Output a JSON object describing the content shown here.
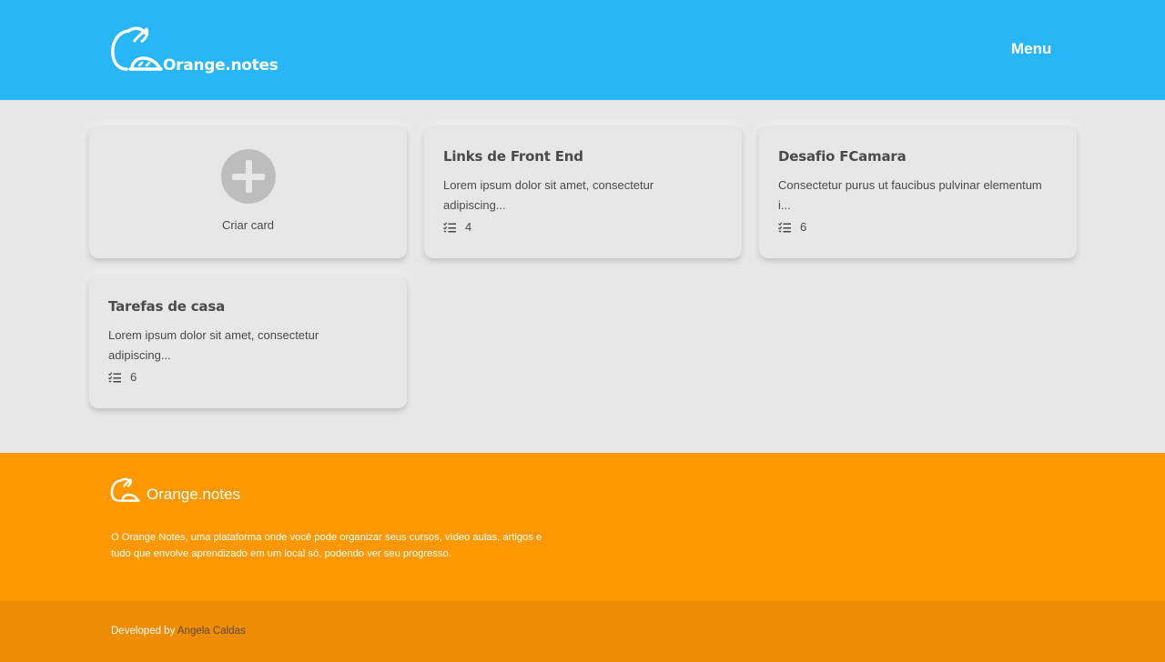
{
  "header": {
    "logo_text": "Orange.notes",
    "menu_label": "Menu"
  },
  "new_card": {
    "label": "Criar card",
    "icon": "plus-circle-icon"
  },
  "cards": [
    {
      "title": "Links de Front End",
      "description": "Lorem ipsum dolor sit amet, consectetur adipiscing...",
      "count": "4"
    },
    {
      "title": "Desafio FCamara",
      "description": "Consectetur purus ut faucibus pulvinar elementum i...",
      "count": "6"
    },
    {
      "title": "Tarefas de casa",
      "description": "Lorem ipsum dolor sit amet, consectetur adipiscing...",
      "count": "6"
    }
  ],
  "footer": {
    "logo_text": "Orange.notes",
    "description": "O Orange Notes, uma plataforma onde você pode organizar seus cursos, vídeo aulas, artigos e tudo que envolve aprendizado em um local só, podendo ver seu progresso.",
    "developed_by": "Developed by",
    "developer_name": "Angela Caldas"
  },
  "colors": {
    "header_bg": "#29b6f6",
    "body_bg": "#e7e7e7",
    "footer_bg": "#ff9800",
    "bottom_bar_bg": "#ef8c05",
    "text_dark": "#4a4a4a"
  }
}
